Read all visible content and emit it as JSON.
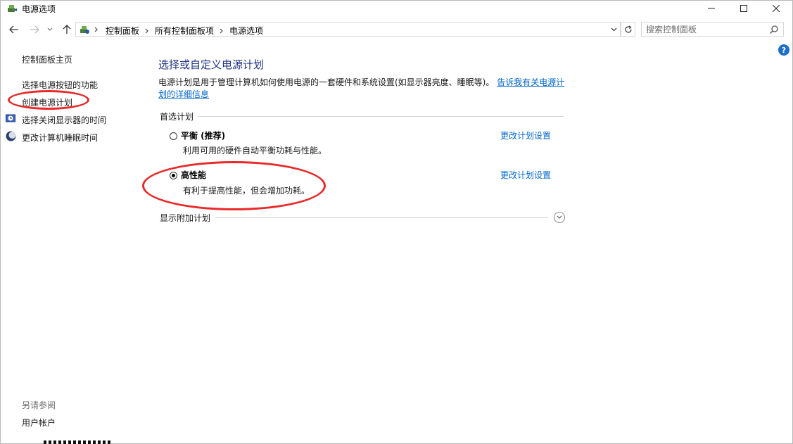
{
  "window": {
    "title": "电源选项"
  },
  "address_bar": {
    "crumbs": [
      "控制面板",
      "所有控制面板项",
      "电源选项"
    ],
    "search_placeholder": "搜索控制面板"
  },
  "sidebar": {
    "home": "控制面板主页",
    "items": [
      "选择电源按钮的功能",
      "创建电源计划",
      "选择关闭显示器的时间",
      "更改计算机睡眠时间"
    ],
    "see_also_label": "另请参阅",
    "see_also_items": [
      "用户帐户"
    ]
  },
  "main": {
    "title": "选择或自定义电源计划",
    "description": "电源计划是用于管理计算机如何使用电源的一套硬件和系统设置(如显示器亮度、睡眠等)。",
    "description_link": "告诉我有关电源计划的详细信息",
    "preferred_label": "首选计划",
    "plans": [
      {
        "name": "平衡 (推荐)",
        "desc": "利用可用的硬件自动平衡功耗与性能。",
        "link": "更改计划设置",
        "selected": false
      },
      {
        "name": "高性能",
        "desc": "有利于提高性能，但会增加功耗。",
        "link": "更改计划设置",
        "selected": true
      }
    ],
    "show_more_label": "显示附加计划"
  },
  "colors": {
    "annotation": "#ea2a2a",
    "link": "#0066cc",
    "title": "#1e3287"
  }
}
